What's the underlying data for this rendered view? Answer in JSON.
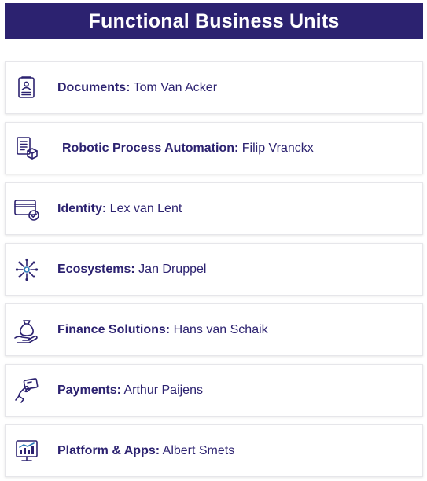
{
  "header": {
    "title": "Functional Business Units"
  },
  "units": [
    {
      "title": "Documents:",
      "name": "Tom Van Acker",
      "icon": "document-icon"
    },
    {
      "title": "Robotic Process Automation:",
      "name": "Filip Vranckx",
      "icon": "robotic-process-icon"
    },
    {
      "title": "Identity:",
      "name": "Lex van Lent",
      "icon": "identity-card-check-icon"
    },
    {
      "title": "Ecosystems:",
      "name": "Jan Druppel",
      "icon": "network-nodes-icon"
    },
    {
      "title": "Finance Solutions:",
      "name": "Hans van Schaik",
      "icon": "money-bag-hand-icon"
    },
    {
      "title": "Payments:",
      "name": "Arthur Paijens",
      "icon": "card-payment-hand-icon"
    },
    {
      "title": "Platform & Apps:",
      "name": "Albert Smets",
      "icon": "dashboard-monitor-icon"
    }
  ],
  "colors": {
    "header_bg": "#2c2270",
    "text": "#2c2270",
    "accent": "#2a7ab8"
  }
}
